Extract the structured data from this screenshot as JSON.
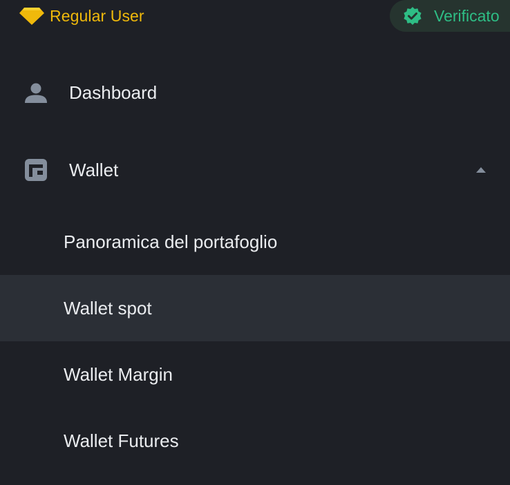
{
  "header": {
    "user_tier": "Regular User",
    "verification": "Verificato"
  },
  "menu": {
    "dashboard": {
      "label": "Dashboard",
      "icon": "user-icon"
    },
    "wallet": {
      "label": "Wallet",
      "icon": "wallet-icon",
      "expanded": true,
      "children": [
        {
          "label": "Panoramica del portafoglio",
          "active": false
        },
        {
          "label": "Wallet spot",
          "active": true
        },
        {
          "label": "Wallet Margin",
          "active": false
        },
        {
          "label": "Wallet Futures",
          "active": false
        }
      ]
    }
  },
  "colors": {
    "background": "#1e2026",
    "active_row": "#2b2f36",
    "brand_yellow": "#f0b90b",
    "verified_green": "#2ebd85",
    "text": "#eaecef",
    "icon_gray": "#848e9c"
  }
}
